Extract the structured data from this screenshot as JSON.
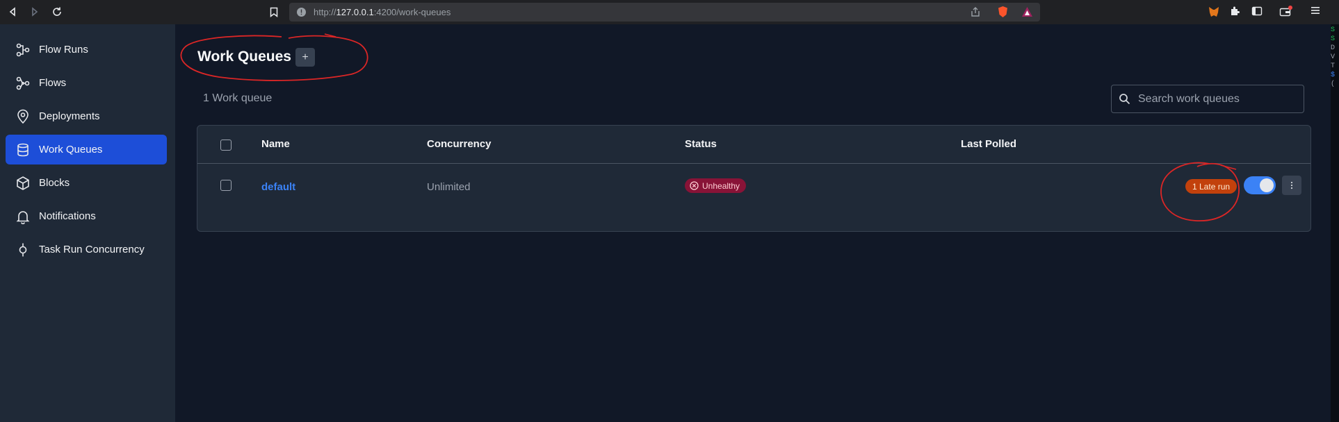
{
  "browser": {
    "url_scheme": "http://",
    "url_host": "127.0.0.1",
    "url_path": ":4200/work-queues"
  },
  "sidebar": {
    "items": [
      {
        "label": "Flow Runs",
        "icon": "flow-runs-icon"
      },
      {
        "label": "Flows",
        "icon": "flows-icon"
      },
      {
        "label": "Deployments",
        "icon": "location-pin-icon"
      },
      {
        "label": "Work Queues",
        "icon": "database-icon",
        "active": true
      },
      {
        "label": "Blocks",
        "icon": "cube-icon"
      },
      {
        "label": "Notifications",
        "icon": "bell-icon"
      },
      {
        "label": "Task Run Concurrency",
        "icon": "commit-icon"
      }
    ]
  },
  "main": {
    "title": "Work Queues",
    "add_label": "+",
    "count_text": "1 Work queue",
    "search": {
      "placeholder": "Search work queues"
    },
    "table": {
      "headers": {
        "name": "Name",
        "concurrency": "Concurrency",
        "status": "Status",
        "last_polled": "Last Polled"
      },
      "rows": [
        {
          "name": "default",
          "concurrency": "Unlimited",
          "status": "Unhealthy",
          "last_polled": "",
          "late_runs": "1 Late run",
          "enabled": true
        }
      ]
    }
  },
  "colors": {
    "accent": "#1d4ed8",
    "link": "#3b82f6",
    "unhealthy_bg": "#881337",
    "late_bg": "#c2410c",
    "annotation": "#dc2626"
  },
  "terminal_strip": [
    "S",
    "S",
    "D",
    "V",
    "",
    "T",
    "$",
    "("
  ]
}
